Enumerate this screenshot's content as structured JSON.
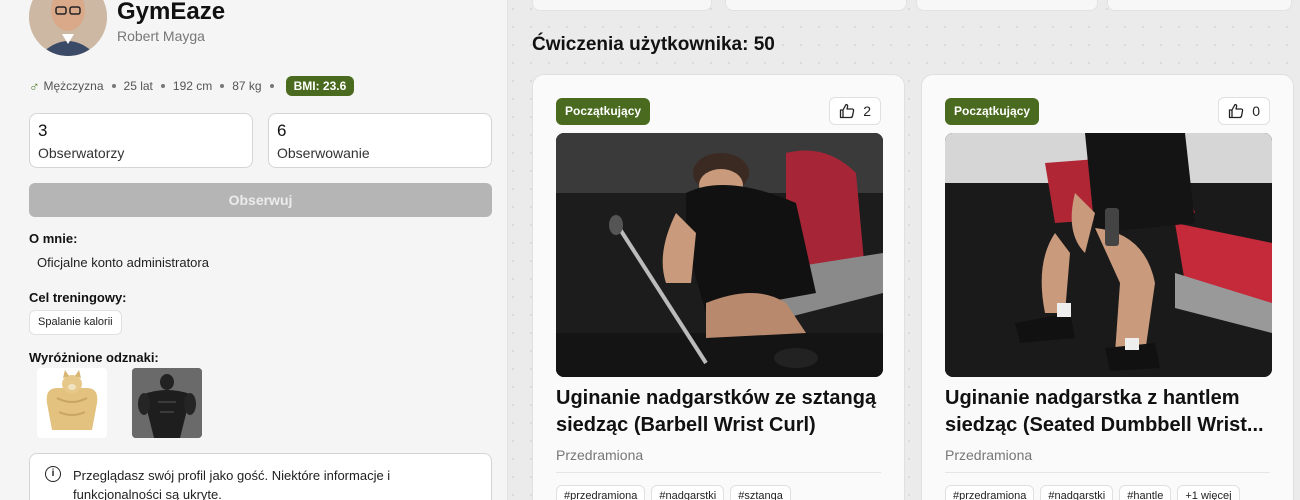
{
  "profile": {
    "app_name": "GymEaze",
    "user_name": "Robert Mayga",
    "gender": "Mężczyzna",
    "age": "25 lat",
    "height": "192 cm",
    "weight": "87 kg",
    "bmi": "BMI: 23.6",
    "followers_count": "3",
    "followers_label": "Obserwatorzy",
    "following_count": "6",
    "following_label": "Obserwowanie",
    "follow_button": "Obserwuj",
    "about_label": "O mnie:",
    "about_text": "Oficjalne konto administratora",
    "goal_label": "Cel treningowy:",
    "goal_value": "Spalanie kalorii",
    "badges_label": "Wyróżnione odznaki:",
    "info_text": "Przeglądasz swój profil jako gość. Niektóre informacje i funkcjonalności są ukryte."
  },
  "exercises": {
    "title": "Ćwiczenia użytkownika: 50",
    "items": [
      {
        "level": "Początkujący",
        "likes": "2",
        "title": "Uginanie nadgarstków ze sztangą siedząc (Barbell Wrist Curl)",
        "muscle": "Przedramiona",
        "tags": [
          "#przedramiona",
          "#nadgarstki",
          "#sztanga"
        ]
      },
      {
        "level": "Początkujący",
        "likes": "0",
        "title": "Uginanie nadgarstka z hantlem siedząc (Seated Dumbbell Wrist...",
        "muscle": "Przedramiona",
        "tags": [
          "#przedramiona",
          "#nadgarstki",
          "#hantle",
          "+1 więcej"
        ]
      }
    ]
  },
  "colors": {
    "accent": "#4a6b1f",
    "button_disabled": "#b5b5b5"
  }
}
